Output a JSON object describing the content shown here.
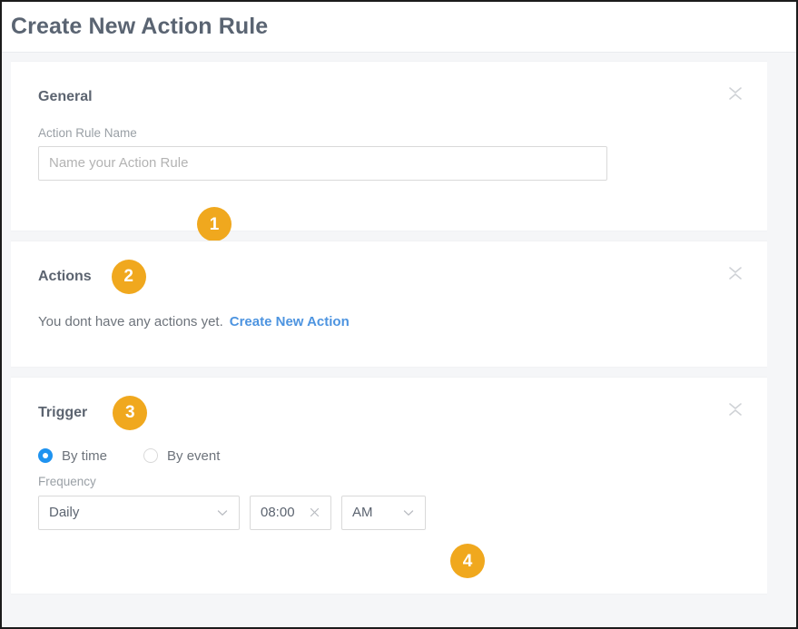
{
  "header": {
    "title": "Create New Action Rule"
  },
  "colors": {
    "badge": "#f0a81e",
    "link": "#4d94e0",
    "radio_selected": "#1f93f0",
    "page_background": "#f5f6f8",
    "card_background": "#ffffff",
    "border": "#d9d9d9",
    "title_text": "#5a6472"
  },
  "sections": {
    "general": {
      "title": "General",
      "badge": "1",
      "collapse_icon": "collapse-icon",
      "field_label": "Action Rule Name",
      "input_value": "",
      "input_placeholder": "Name your Action Rule"
    },
    "actions": {
      "title": "Actions",
      "badge": "2",
      "collapse_icon": "collapse-icon",
      "empty_text": "You dont have any actions yet.",
      "create_link": "Create New Action"
    },
    "trigger": {
      "title": "Trigger",
      "badge": "3",
      "collapse_icon": "collapse-icon",
      "radios": [
        {
          "label": "By time",
          "selected": true
        },
        {
          "label": "By event",
          "selected": false
        }
      ],
      "frequency_label": "Frequency",
      "frequency_value": "Daily",
      "time_value": "08:00",
      "time_clear_icon": "clear-icon",
      "meridiem_value": "AM",
      "badge_4": "4"
    }
  }
}
